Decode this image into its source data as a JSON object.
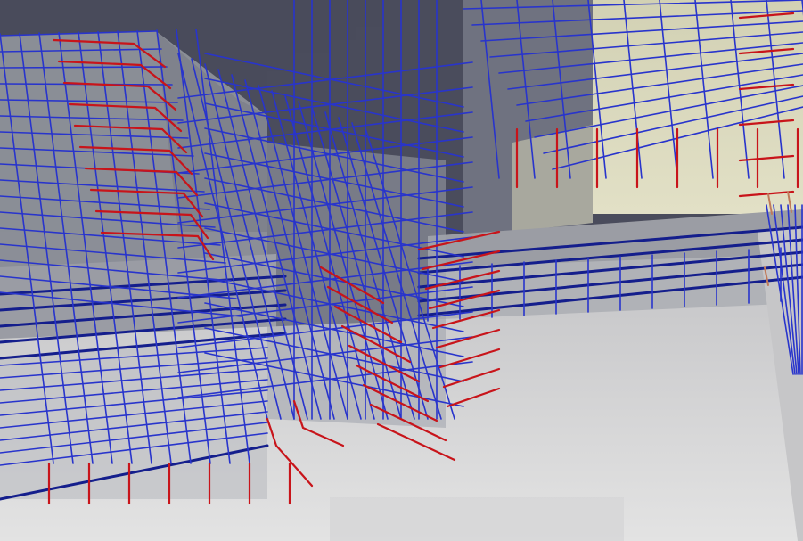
{
  "scene": {
    "description_shown": "",
    "colors": {
      "background_upper": "#4a4c5c",
      "background_mid": "#8f929b",
      "floor_light": "#d9d9d9",
      "floor_shadow": "#b8b9bd",
      "concrete_beam": "#a7a9ae",
      "slab_left": "#8d9099",
      "slab_right_cream": "#d8d6b8",
      "rebar_blue": "#2532c8",
      "rebar_blue_dark": "#141e8c",
      "rebar_red": "#c8141a",
      "rebar_orange": "#c07a5a"
    }
  }
}
